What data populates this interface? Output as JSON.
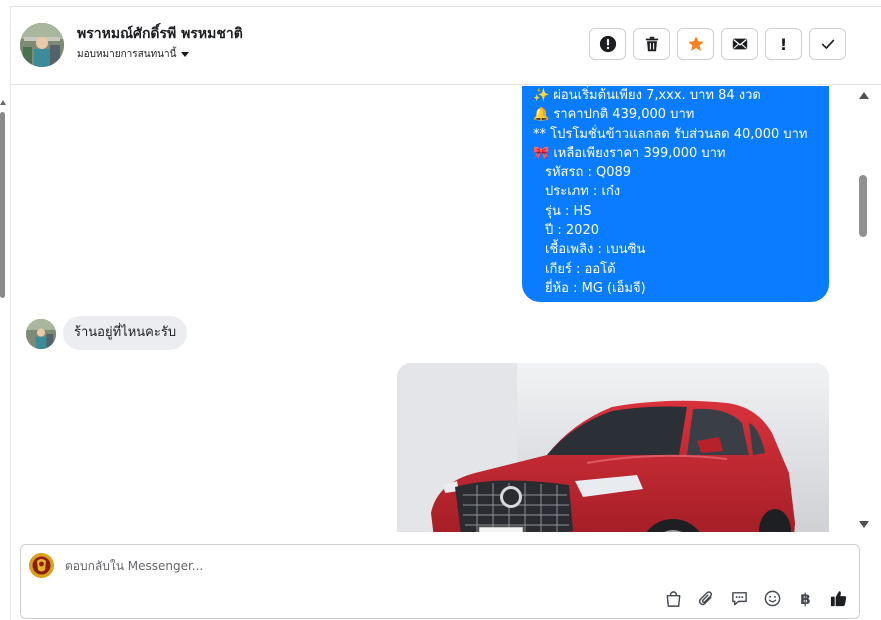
{
  "header": {
    "contact_name": "พราหมณ์ศักดิ์รพี พรหมชาติ",
    "assign_label": "มอบหมายการสนทนานี้"
  },
  "actions": [
    {
      "name": "spam-button",
      "icon": "alert-circle-icon"
    },
    {
      "name": "delete-button",
      "icon": "trash-icon"
    },
    {
      "name": "star-button",
      "icon": "star-icon",
      "color": "#f5821f"
    },
    {
      "name": "mark-unread-button",
      "icon": "envelope-icon"
    },
    {
      "name": "follow-up-button",
      "icon": "exclamation-icon",
      "label": "!"
    },
    {
      "name": "mark-done-button",
      "icon": "check-icon"
    }
  ],
  "conversation": {
    "outgoing_lines": [
      "✨  ผ่อนเริ่มต้นเพียง 7,xxx. บาท 84 งวด",
      "🔔   ราคาปกติ 439,000 บาท",
      "** โปรโมชั่นข้าวแลกลด รับส่วนลด 40,000 บาท",
      "🎀  เหลือเพียงราคา 399,000 บาท",
      "รหัสรถ : Q089",
      "ประเภท : เก๋ง",
      "รุ่น : HS",
      "ปี : 2020",
      "เชื้อเพลิง : เบนซิน",
      "เกียร์ : ออโต้",
      "ยี่ห้อ : MG (เอ็มจี)"
    ],
    "incoming_text": "ร้านอยู่ที่ไหนคะรับ",
    "photo_icon": "car-photo",
    "bubble_color": "#0a7cff"
  },
  "composer": {
    "placeholder": "ตอบกลับใน Messenger...",
    "tools": [
      "bag-icon",
      "paperclip-icon",
      "saved-replies-icon",
      "emoji-icon",
      "baht-icon",
      "thumbs-up-icon"
    ],
    "baht_symbol": "฿"
  }
}
